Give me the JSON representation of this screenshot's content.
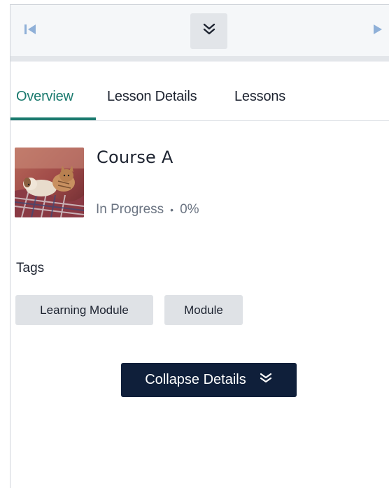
{
  "topbar": {
    "first_icon": "skip-to-first-icon",
    "expand_icon": "double-chevron-down-icon",
    "next_icon": "play-next-icon"
  },
  "tabs": [
    {
      "label": "Overview",
      "active": true
    },
    {
      "label": "Lesson Details",
      "active": false
    },
    {
      "label": "Lessons",
      "active": false
    }
  ],
  "course": {
    "title": "Course A",
    "thumbnail": "dog-and-cat-on-blanket-image",
    "status": "In Progress",
    "separator": "•",
    "progress": "0%"
  },
  "tags": {
    "heading": "Tags",
    "items": [
      "Learning Module",
      "Module"
    ]
  },
  "collapse": {
    "label": "Collapse Details",
    "icon": "double-chevron-down-icon"
  },
  "colors": {
    "accent": "#1a7a6e",
    "button_dark": "#0f1f3a",
    "tag_bg": "#dfe2e6",
    "muted_text": "#6b7482"
  }
}
